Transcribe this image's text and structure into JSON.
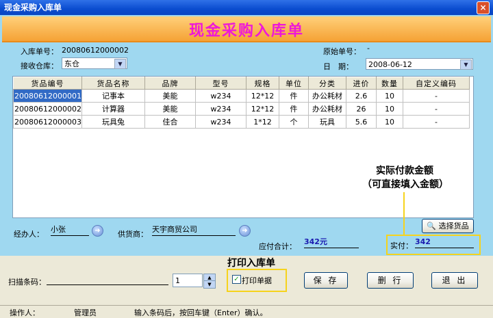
{
  "window": {
    "title": "现金采购入库单",
    "close_glyph": "×"
  },
  "banner": {
    "title": "现金采购入库单"
  },
  "header": {
    "order_no_label": "入库单号：",
    "order_no_value": "20080612000002",
    "warehouse_label": "接收仓库：",
    "warehouse_value": "东仓",
    "orig_no_label": "原始单号：",
    "orig_no_value": "-",
    "date_label": "日　期：",
    "date_value": "2008-06-12"
  },
  "table": {
    "columns": [
      "货品编号",
      "货品名称",
      "品牌",
      "型号",
      "规格",
      "单位",
      "分类",
      "进价",
      "数量",
      "自定义编码"
    ],
    "rows": [
      [
        "20080612000001",
        "记事本",
        "美能",
        "w234",
        "12*12",
        "件",
        "办公耗材",
        "2.6",
        "10",
        "-"
      ],
      [
        "20080612000002",
        "计算器",
        "美能",
        "w234",
        "12*12",
        "件",
        "办公耗材",
        "26",
        "10",
        "-"
      ],
      [
        "20080612000003",
        "玩具兔",
        "佳合",
        "w234",
        "1*12",
        "个",
        "玩具",
        "5.6",
        "10",
        "-"
      ]
    ]
  },
  "annotation_payment": {
    "line1": "实际付款金额",
    "line2": "（可直接填入金额）"
  },
  "annotation_print": "打印入库单",
  "footer": {
    "handler_label": "经办人：",
    "handler_value": "小张",
    "supplier_label": "供货商：",
    "supplier_value": "天宇商贸公司",
    "choose_goods_label": "选择货品",
    "payable_label": "应付合计：",
    "payable_value": "342元",
    "actual_label": "实付：",
    "actual_value": "342"
  },
  "controls": {
    "barcode_label": "扫描条码：",
    "barcode_value": "",
    "qty_value": "1",
    "print_checkbox_label": "打印单据",
    "save_label": "保 存",
    "delete_label": "删 行",
    "exit_label": "退 出"
  },
  "status": {
    "operator_label": "操作人：",
    "operator_value": "管理员",
    "hint": "输入条码后，按回车键（Enter）确认。"
  }
}
